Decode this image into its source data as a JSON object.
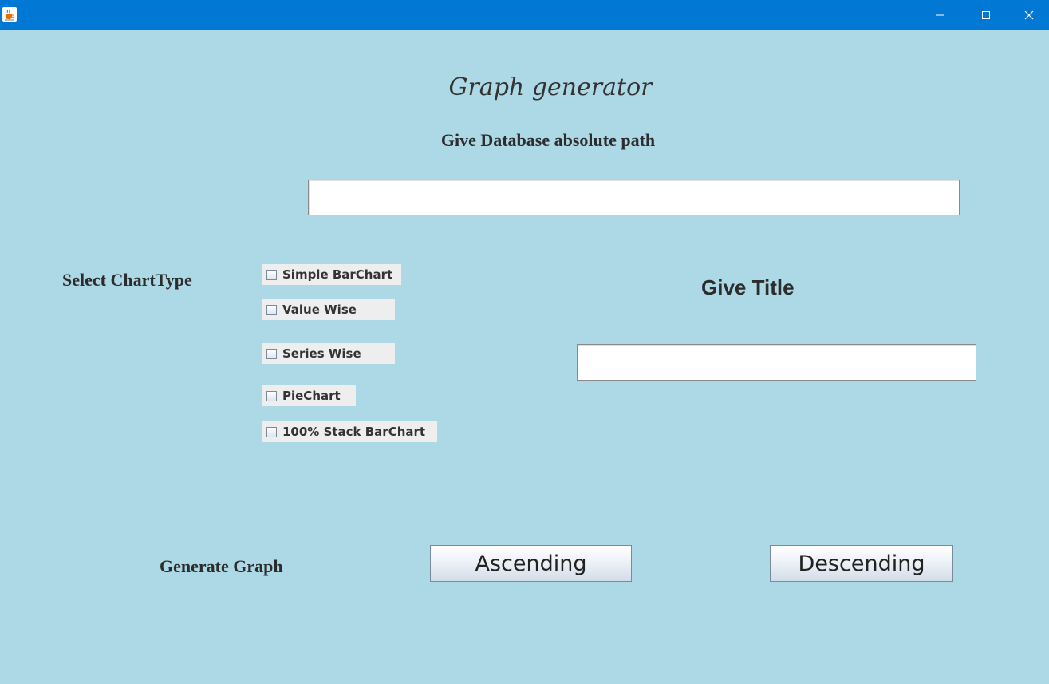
{
  "window": {
    "icon": "java-cup-icon",
    "controls": [
      "minimize-icon",
      "maximize-icon",
      "close-icon"
    ]
  },
  "main": {
    "title": "Graph generator",
    "db_path_label": "Give Database absolute path",
    "db_path_value": "",
    "chart_type_label": "Select ChartType",
    "chart_types": [
      {
        "label": "Simple BarChart",
        "checked": false
      },
      {
        "label": "Value Wise",
        "checked": false
      },
      {
        "label": "Series Wise",
        "checked": false
      },
      {
        "label": "PieChart",
        "checked": false
      },
      {
        "label": "100% Stack BarChart",
        "checked": false
      }
    ],
    "give_title_label": "Give Title",
    "title_value": "",
    "generate_label": "Generate Graph",
    "ascending_label": "Ascending",
    "descending_label": "Descending"
  },
  "colors": {
    "titlebar": "#0078d4",
    "background": "#add8e6"
  }
}
